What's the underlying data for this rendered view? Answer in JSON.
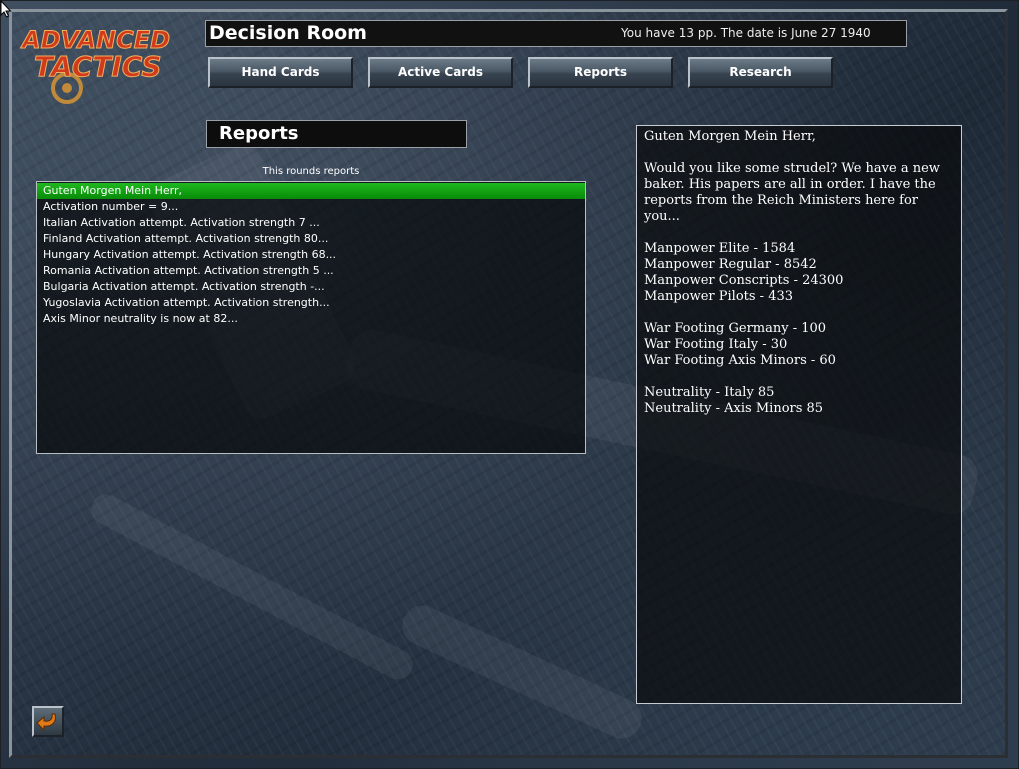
{
  "logo": {
    "line1": "ADVANCED",
    "line2": "TACTICS"
  },
  "header": {
    "title": "Decision Room",
    "info": "You have 13 pp. The date is June 27 1940"
  },
  "nav": {
    "hand_cards": "Hand Cards",
    "active_cards": "Active Cards",
    "reports": "Reports",
    "research": "Research"
  },
  "section": {
    "title": "Reports"
  },
  "reports_list": {
    "caption": "This rounds reports",
    "items": [
      "Guten Morgen Mein Herr,",
      "Activation number = 9...",
      "Italian Activation attempt. Activation strength 7 ...",
      "Finland Activation attempt. Activation strength 80...",
      "Hungary Activation attempt. Activation strength 68...",
      "Romania Activation attempt. Activation strength 5 ...",
      "Bulgaria Activation attempt. Activation strength -...",
      "Yugoslavia Activation attempt. Activation strength...",
      "Axis Minor neutrality is now at 82..."
    ],
    "selected_index": 0
  },
  "report_text": {
    "greeting": "Guten Morgen Mein Herr,",
    "intro": "Would you like some strudel? We have a new baker. His papers are all in order. I have the reports from the Reich Ministers here for you...",
    "manpower": [
      "Manpower Elite - 1584",
      "Manpower Regular - 8542",
      "Manpower Conscripts - 24300",
      "Manpower Pilots - 433"
    ],
    "war_footing": [
      "War Footing Germany - 100",
      "War Footing Italy - 30",
      "War Footing Axis Minors - 60"
    ],
    "neutrality": [
      "Neutrality - Italy 85",
      "Neutrality - Axis Minors 85"
    ]
  },
  "colors": {
    "selection": "#13a313",
    "logo_red": "#d23a1c",
    "logo_orange": "#e8a040"
  },
  "icons": {
    "back": "back-arrow-icon",
    "cursor": "mouse-cursor-icon"
  }
}
